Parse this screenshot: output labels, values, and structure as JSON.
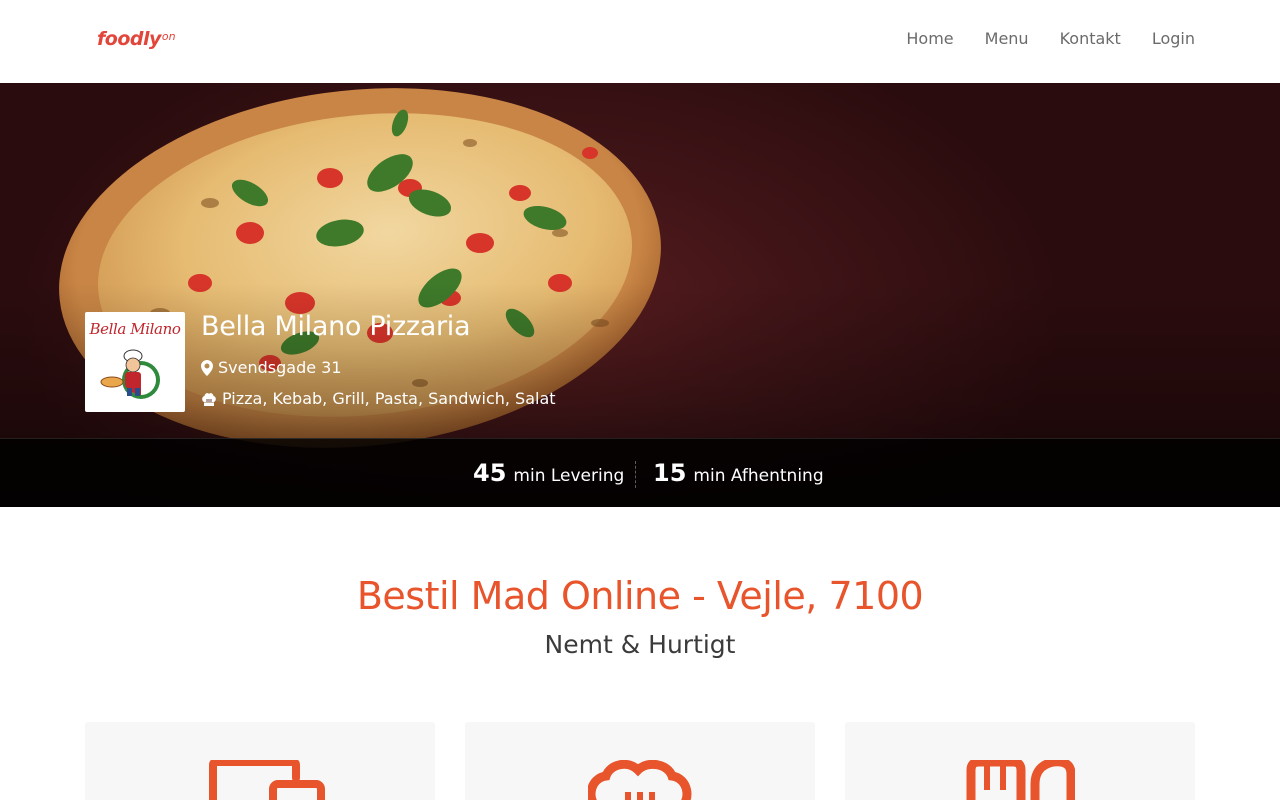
{
  "header": {
    "logo": {
      "main": "foodly",
      "sup": "on"
    },
    "nav": [
      "Home",
      "Menu",
      "Kontakt",
      "Login"
    ]
  },
  "restaurant": {
    "logo_text": "Bella Milano",
    "name": "Bella Milano Pizzaria",
    "address": "Svendsgade 31",
    "categories": "Pizza, Kebab, Grill, Pasta, Sandwich, Salat",
    "icons": {
      "address": "map-marker-icon",
      "categories": "chef-hat-icon"
    }
  },
  "stats": [
    {
      "value": "45",
      "label": "min Levering"
    },
    {
      "value": "15",
      "label": "min Afhentning"
    }
  ],
  "main": {
    "title": "Bestil Mad Online - Vejle, 7100",
    "subtitle": "Nemt & Hurtigt"
  },
  "features": [
    {
      "icon": "devices-icon"
    },
    {
      "icon": "chef-hat-icon"
    },
    {
      "icon": "cutlery-icon"
    }
  ],
  "colors": {
    "brand": "#e2453a",
    "accent": "#e8542b",
    "hero_bg": "#421518",
    "card_bg": "#f7f7f7"
  }
}
